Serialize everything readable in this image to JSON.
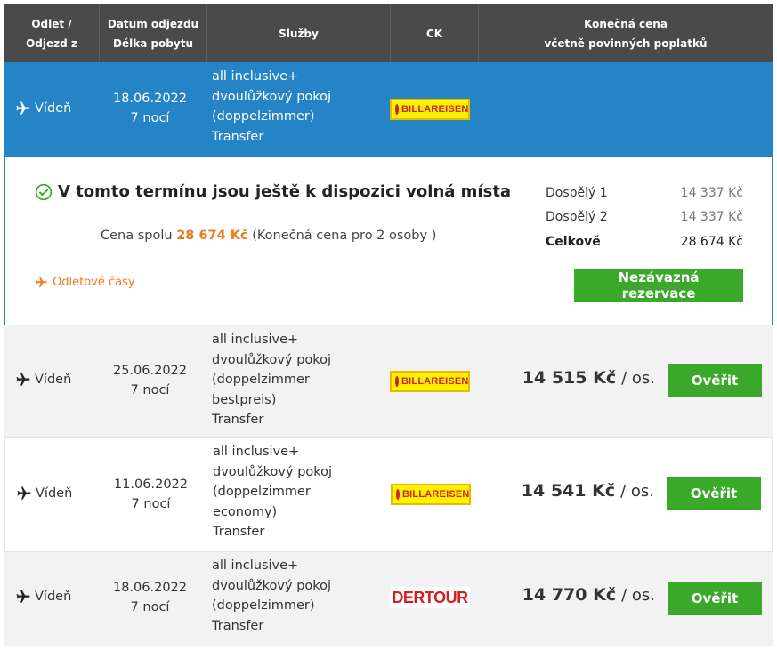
{
  "header": {
    "col1_line1": "Odlet /",
    "col1_line2": "Odjezd z",
    "col2_line1": "Datum odjezdu",
    "col2_line2": "Délka pobytu",
    "col3": "Služby",
    "col4": "CK",
    "col5_line1": "Konečná cena",
    "col5_line2": "včetně povinných poplatků"
  },
  "selected": {
    "departure": "Vídeň",
    "date": "18.06.2022",
    "length": "7 nocí",
    "services": [
      "all inclusive+",
      "dvoulůžkový pokoj",
      "(doppelzimmer)",
      "Transfer"
    ],
    "operator": "BILLA REISEN"
  },
  "detail": {
    "availability": "V tomto termínu jsou ještě k dispozici volná místa",
    "total_prefix": "Cena spolu",
    "total_amount": "28 674 Kč",
    "total_suffix": "(Konečná cena pro 2 osoby )",
    "flight_times": "Odletové časy",
    "breakdown": [
      {
        "label": "Dospělý 1",
        "value": "14 337 Kč"
      },
      {
        "label": "Dospělý 2",
        "value": "14 337 Kč"
      }
    ],
    "total_label": "Celkově",
    "total_value": "28 674 Kč",
    "reserve_button": "Nezávazná rezervace"
  },
  "offers": [
    {
      "departure": "Vídeň",
      "date": "25.06.2022",
      "length": "7 nocí",
      "services": [
        "all inclusive+",
        "dvoulůžkový pokoj",
        "(doppelzimmer",
        "bestpreis)",
        "Transfer"
      ],
      "operator": "BILLA REISEN",
      "price": "14 515 Kč",
      "per": "/ os.",
      "button": "Ověřit"
    },
    {
      "departure": "Vídeň",
      "date": "11.06.2022",
      "length": "7 nocí",
      "services": [
        "all inclusive+",
        "dvoulůžkový pokoj",
        "(doppelzimmer",
        "economy)",
        "Transfer"
      ],
      "operator": "BILLA REISEN",
      "price": "14 541 Kč",
      "per": "/ os.",
      "button": "Ověřit"
    },
    {
      "departure": "Vídeň",
      "date": "18.06.2022",
      "length": "7 nocí",
      "services": [
        "all inclusive+",
        "dvoulůžkový pokoj",
        "(doppelzimmer)",
        "Transfer"
      ],
      "operator": "DERTOUR",
      "price": "14 770 Kč",
      "per": "/ os.",
      "button": "Ověřit"
    }
  ],
  "colors": {
    "header_bg": "#4a4a4a",
    "selected_bg": "#2584c5",
    "accent_orange": "#ee7a1e",
    "button_green": "#3aa829"
  }
}
